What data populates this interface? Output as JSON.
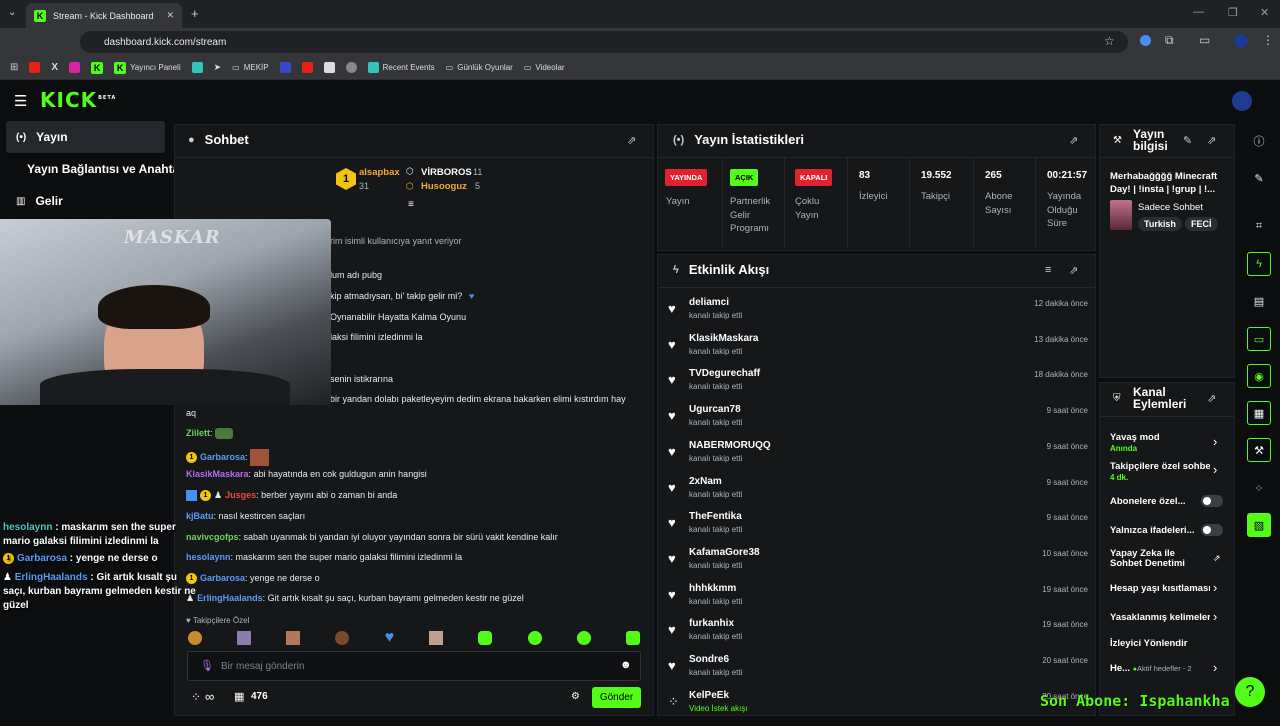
{
  "browser": {
    "tab_title": "Stream - Kick Dashboard",
    "url": "dashboard.kick.com/stream",
    "bookmarks": [
      "Yayıncı Paneli",
      "MEKİP",
      "Recent Events",
      "Günlük Oyunlar",
      "Videolar"
    ]
  },
  "brand": {
    "logo": "KICK",
    "beta": "BETA",
    "accent": "#53fc18"
  },
  "sidebar": {
    "items": [
      {
        "label": "Yayın",
        "icon": "broadcast-icon",
        "active": true
      },
      {
        "label": "Yayın Bağlantısı ve Anahtarı",
        "icon": "",
        "active": false
      },
      {
        "label": "Gelir",
        "icon": "chart-icon",
        "active": false
      }
    ]
  },
  "webcam": {
    "watermark": "MASKAR"
  },
  "overlay_chat": [
    {
      "user": "hesolaynn",
      "text": " : maskarım sen the super mario galaksi filimini izledinmi la",
      "color": "#4cc6c1"
    },
    {
      "user": "Garbarosa",
      "text": " : yenge ne derse o",
      "color": "#5b9bf5"
    },
    {
      "user": "ErlingHaalands",
      "text": " : Git artık kısalt şu saçı, kurban bayramı gelmeden kestir ne güzel",
      "color": "#5b9bf5"
    }
  ],
  "chat": {
    "title": "Sohbet",
    "leaderboard": [
      {
        "rank": "1",
        "name": "alsapbax",
        "count": "31"
      },
      {
        "name": "VİRBOROS",
        "count": "11"
      },
      {
        "name": "Husooguz",
        "count": "5"
      }
    ],
    "reply_notice": "rim isimli kullanıcıya yanıt veriyor",
    "partial_lines": [
      "lum adı pubg",
      "kip atmadıysan, bi' takip gelir mi?",
      "Oynanabilir Hayatta Kalma Oyunu",
      "laksi filimini izledinmi la",
      "senin istikrarına",
      " bir yandan dolabı paketleyeyim dedim ekrana bakarken elimi kıstırdım hay"
    ],
    "wrap_line": "aq",
    "messages": [
      {
        "user": "Ziilett",
        "sep": ":",
        "text": "",
        "cls": "u-green"
      },
      {
        "user": "Garbarosa",
        "sep": ":",
        "text": "",
        "cls": "u-blue"
      },
      {
        "user": "KlasikMaskara",
        "sep": ":",
        "text": " abi hayatında en cok guldugun anin hangisi",
        "cls": "u-purple"
      },
      {
        "user": "Jusges",
        "sep": ":",
        "text": " berber yayını abi o zaman bi anda",
        "cls": "u-red"
      },
      {
        "user": "kjBatu",
        "sep": ":",
        "text": " nasıl kestircen saçları",
        "cls": "u-blue"
      },
      {
        "user": "navivcgofps",
        "sep": ":",
        "text": " sabah uyanmak bi yandan iyi oluyor yayından sonra bir sürü vakit kendine kalır",
        "cls": "u-green"
      },
      {
        "user": "hesolaynn",
        "sep": ":",
        "text": " maskarım sen the super mario galaksi filimini izledinmi la",
        "cls": "u-blue"
      },
      {
        "user": "Garbarosa",
        "sep": ":",
        "text": " yenge ne derse o",
        "cls": "u-blue"
      },
      {
        "user": "ErlingHaalands",
        "sep": ":",
        "text": " Git artık kısalt şu saçı, kurban bayramı gelmeden kestir ne güzel",
        "cls": "u-blue"
      }
    ],
    "followers_only": "Takipçilere Özel",
    "input_placeholder": "Bir mesaj gönderin",
    "count": "476",
    "infinity": "∞",
    "send_label": "Gönder"
  },
  "stats": {
    "title": "Yayın İstatistikleri",
    "cols": [
      {
        "pill": "YAYINDA",
        "pill_color": "#e0232f",
        "label": "Yayın"
      },
      {
        "pill": "AÇIK",
        "pill_color": "#53fc18",
        "label": "Partnerlik\nGelir\nProgramı"
      },
      {
        "pill": "KAPALI",
        "pill_color": "#e0232f",
        "label": "Çoklu\nYayın"
      },
      {
        "value": "83",
        "label": "İzleyici"
      },
      {
        "value": "19.552",
        "label": "Takipçi"
      },
      {
        "value": "265",
        "label": "Abone\nSayısı"
      },
      {
        "value": "00:21:57",
        "label": "Yayında\nOlduğu\nSüre"
      }
    ]
  },
  "activity": {
    "title": "Etkinlik Akışı",
    "items": [
      {
        "name": "deliamci",
        "sub": "kanalı takip etti",
        "time": "12 dakika önce"
      },
      {
        "name": "KlasikMaskara",
        "sub": "kanalı takip etti",
        "time": "13 dakika önce"
      },
      {
        "name": "TVDegurechaff",
        "sub": "kanalı takip etti",
        "time": "18 dakika önce"
      },
      {
        "name": "Ugurcan78",
        "sub": "kanalı takip etti",
        "time": "9 saat önce"
      },
      {
        "name": "NABERMORUQQ",
        "sub": "kanalı takip etti",
        "time": "9 saat önce"
      },
      {
        "name": "2xNam",
        "sub": "kanalı takip etti",
        "time": "9 saat önce"
      },
      {
        "name": "TheFentika",
        "sub": "kanalı takip etti",
        "time": "9 saat önce"
      },
      {
        "name": "KafamaGore38",
        "sub": "kanalı takip etti",
        "time": "10 saat önce"
      },
      {
        "name": "hhhkkmm",
        "sub": "kanalı takip etti",
        "time": "19 saat önce"
      },
      {
        "name": "furkanhix",
        "sub": "kanalı takip etti",
        "time": "19 saat önce"
      },
      {
        "name": "Sondre6",
        "sub": "kanalı takip etti",
        "time": "20 saat önce"
      },
      {
        "name": "KelPeEk",
        "sub": "Video İstek akışı",
        "time": "20 saat önce"
      }
    ]
  },
  "stream_info": {
    "title": "Yayın bilgisi",
    "stream_title": "Merhabağğğğ Minecraft Day! | !insta | !grup | !...",
    "category": "Sadece Sohbet",
    "tags": [
      "Turkish",
      "FECİ"
    ]
  },
  "channel_actions": {
    "title": "Kanal Eylemleri",
    "rows": [
      {
        "label": "Yavaş mod",
        "sub": "Anında",
        "control": "chevron"
      },
      {
        "label": "Takipçilere özel sohbet",
        "sub": "4 dk.",
        "control": "chevron"
      },
      {
        "label": "Abonelere özel...",
        "sub": "",
        "control": "toggle"
      },
      {
        "label": "Yalnızca ifadeleri...",
        "sub": "",
        "control": "toggle"
      },
      {
        "label": "Yapay Zeka ile Sohbet Denetimi",
        "sub": "",
        "control": "external"
      },
      {
        "label": "Hesap yaşı kısıtlaması",
        "sub": "",
        "control": "chevron"
      },
      {
        "label": "Yasaklanmış kelimeler",
        "sub": "",
        "control": "chevron"
      },
      {
        "label": "İzleyici Yönlendir",
        "sub": "",
        "control": "none"
      },
      {
        "label": "He...",
        "sub": "Aktif hedefler - 2",
        "control": "chevron"
      }
    ]
  },
  "ticker": "Son Abone: Ispahankha"
}
